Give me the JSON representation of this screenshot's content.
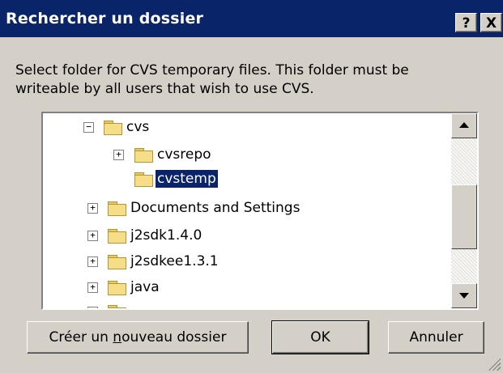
{
  "window": {
    "title": "Rechercher un dossier",
    "help_label": "?",
    "close_label": "X"
  },
  "description": "Select folder for CVS temporary files.  This folder must be writeable by all users that wish to use CVS.",
  "tree": {
    "items": [
      {
        "label": "cvs",
        "expander": "−",
        "icon": "folder-open-icon"
      },
      {
        "label": "cvsrepo",
        "expander": "+",
        "icon": "folder-icon"
      },
      {
        "label": "cvstemp",
        "expander": "",
        "icon": "folder-open-icon",
        "selected": true
      },
      {
        "label": "Documents and Settings",
        "expander": "+",
        "icon": "folder-icon"
      },
      {
        "label": "j2sdk1.4.0",
        "expander": "+",
        "icon": "folder-icon"
      },
      {
        "label": "j2sdkee1.3.1",
        "expander": "+",
        "icon": "folder-icon"
      },
      {
        "label": "java",
        "expander": "+",
        "icon": "folder-icon"
      }
    ]
  },
  "buttons": {
    "new_folder_prefix": "Créer un ",
    "new_folder_accel": "n",
    "new_folder_suffix": "ouveau dossier",
    "ok": "OK",
    "cancel": "Annuler"
  },
  "colors": {
    "titlebar": "#0a246a",
    "dialog_bg": "#d4d0c8",
    "selection": "#0a246a"
  }
}
